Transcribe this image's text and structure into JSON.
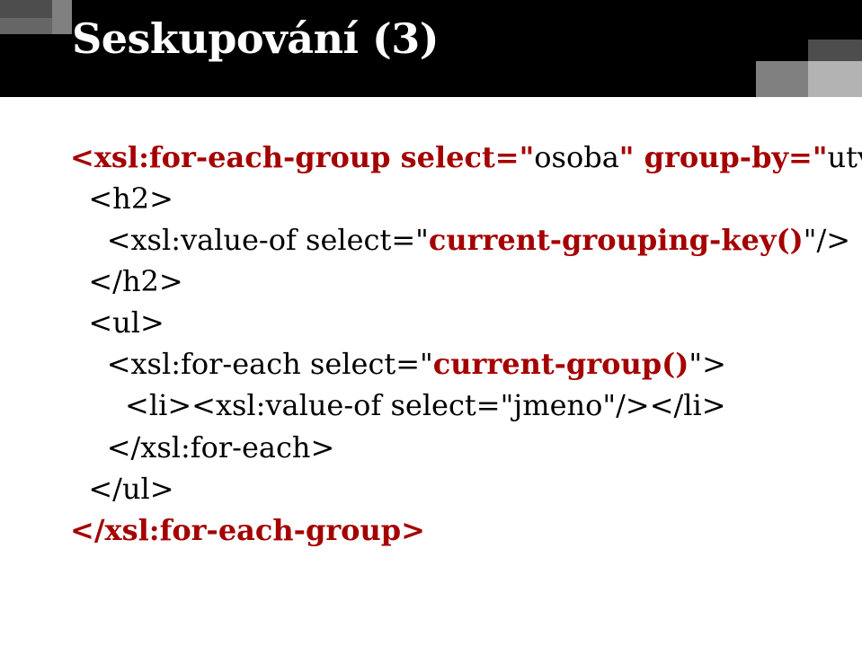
{
  "title": "Seskupování (3)",
  "code": {
    "l1a": "<xsl:for-each-group select=\"",
    "l1b": "osoba",
    "l1c": "\" group-by=\"",
    "l1d": "utvar",
    "l1e": "\">",
    "l2": "  <h2>",
    "l3a": "    <xsl:value-of select=\"",
    "l3b": "current-grouping-key()",
    "l3c": "\"/>",
    "l4": "  </h2>",
    "l5": "  <ul>",
    "l6a": "    <xsl:for-each select=\"",
    "l6b": "current-group()",
    "l6c": "\">",
    "l7a": "      <li><xsl:value-of select=\"",
    "l7b": "jmeno",
    "l7c": "\"/></li>",
    "l8": "    </xsl:for-each>",
    "l9": "  </ul>",
    "l10": "</xsl:for-each-group>"
  }
}
